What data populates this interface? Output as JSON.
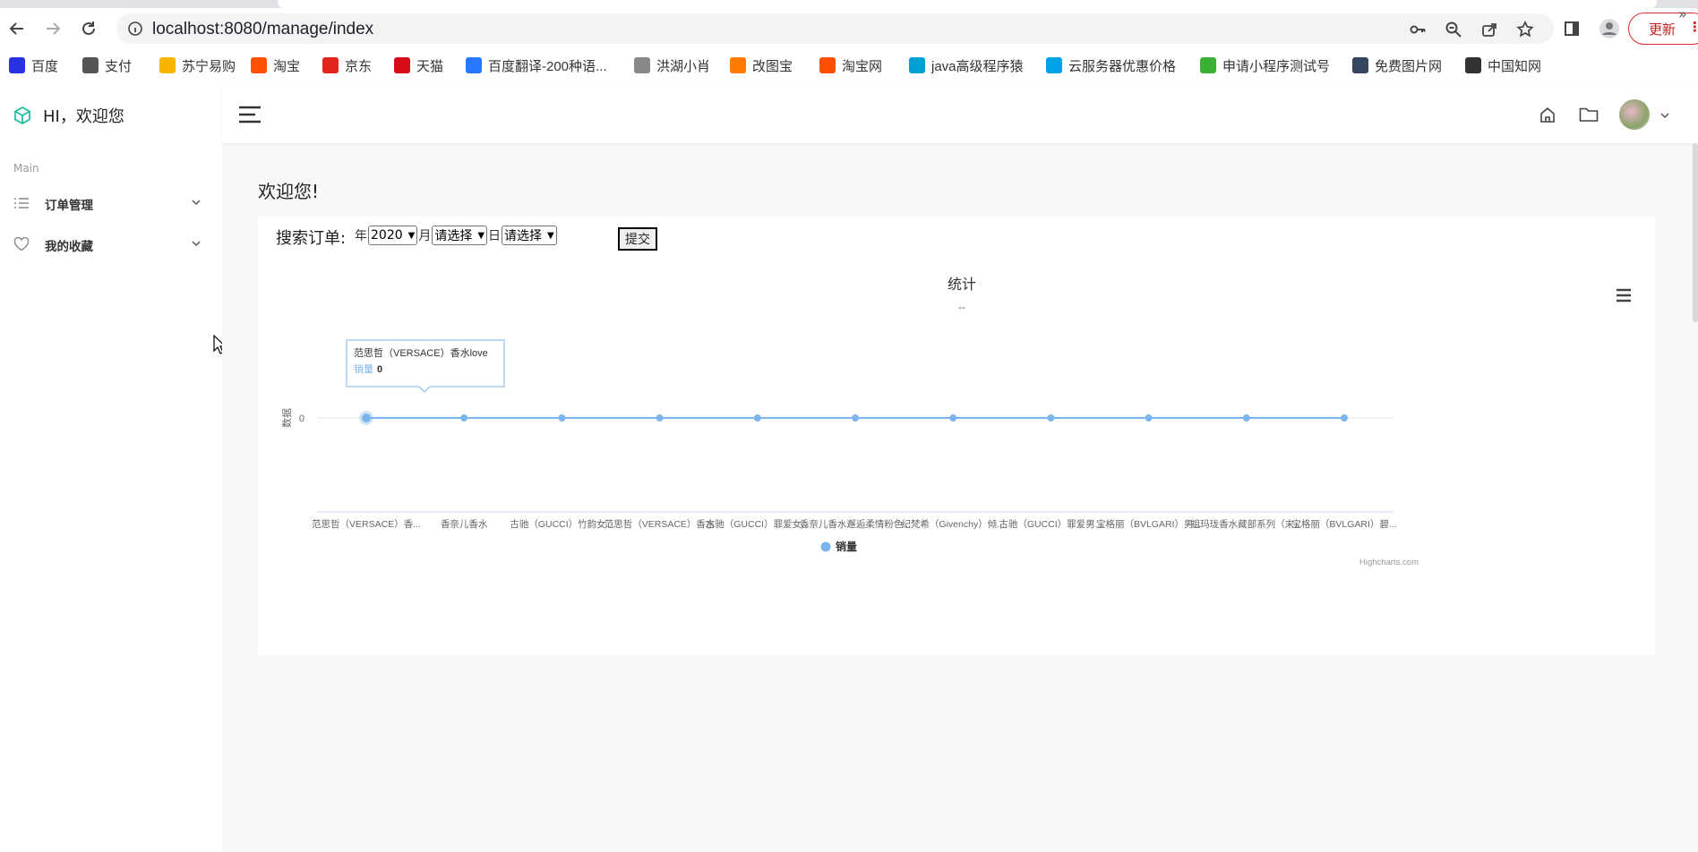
{
  "browser": {
    "url": "localhost:8080/manage/index",
    "update_label": "更新",
    "bookmarks": [
      {
        "label": "百度",
        "icon": "baidu-icon",
        "color": "#2932e1"
      },
      {
        "label": "支付",
        "icon": "globe-icon",
        "color": "#555555"
      },
      {
        "label": "苏宁易购",
        "icon": "suning-icon",
        "color": "#f7b500"
      },
      {
        "label": "淘宝",
        "icon": "taobao-icon",
        "color": "#ff5000"
      },
      {
        "label": "京东",
        "icon": "jd-icon",
        "color": "#e1251b"
      },
      {
        "label": "天猫",
        "icon": "tmall-icon",
        "color": "#d70b19"
      },
      {
        "label": "百度翻译-200种语...",
        "icon": "translate-icon",
        "color": "#2878ff"
      },
      {
        "label": "洪湖小肖",
        "icon": "bird-icon",
        "color": "#888888"
      },
      {
        "label": "改图宝",
        "icon": "gaitubao-icon",
        "color": "#ff7a00"
      },
      {
        "label": "淘宝网",
        "icon": "taobao-icon",
        "color": "#ff5000"
      },
      {
        "label": "java高级程序猿",
        "icon": "bilibili-icon",
        "color": "#00a1d6"
      },
      {
        "label": "云服务器优惠价格",
        "icon": "cloud-icon",
        "color": "#00a2e8"
      },
      {
        "label": "申请小程序测试号",
        "icon": "wechat-icon",
        "color": "#3cb034"
      },
      {
        "label": "免费图片网",
        "icon": "tumblr-icon",
        "color": "#36465d"
      },
      {
        "label": "中国知网",
        "icon": "cnki-icon",
        "color": "#333333"
      }
    ]
  },
  "sidebar": {
    "brand": "HI，欢迎您",
    "section": "Main",
    "items": [
      {
        "label": "订单管理",
        "icon": "list-icon"
      },
      {
        "label": "我的收藏",
        "icon": "heart-icon"
      }
    ]
  },
  "main": {
    "welcome": "欢迎您!",
    "search": {
      "label": "搜索订单:",
      "year_label": "年",
      "year_value": "2020",
      "month_label": "月",
      "month_value": "请选择",
      "day_label": "日",
      "day_value": "请选择",
      "submit": "提交"
    }
  },
  "chart_data": {
    "type": "line",
    "title": "统计",
    "subtitle": "--",
    "ylabel": "数据",
    "yticks": [
      "0"
    ],
    "categories": [
      "范思哲（VERSACE）香...",
      "香奈儿香水",
      "古驰（GUCCI）竹韵女...",
      "范思哲（VERSACE）香水",
      "古驰（GUCCI）罪爱女...",
      "香奈儿香水邂逅柔情粉色...",
      "纪梵希（Givenchy）倾...",
      "古驰（GUCCI）罪爱男...",
      "宝格丽（BVLGARI）男...",
      "祖玛珑香水藏部系列（末...",
      "宝格丽（BVLGARI）碧..."
    ],
    "series": [
      {
        "name": "销量",
        "values": [
          0,
          0,
          0,
          0,
          0,
          0,
          0,
          0,
          0,
          0,
          0
        ],
        "color": "#7cb5ec"
      }
    ],
    "legend": "bottom-center",
    "tooltip": {
      "title": "范思哲（VERSACE）香水love",
      "series": "销量",
      "value": "0"
    },
    "credits": "Highcharts.com"
  }
}
